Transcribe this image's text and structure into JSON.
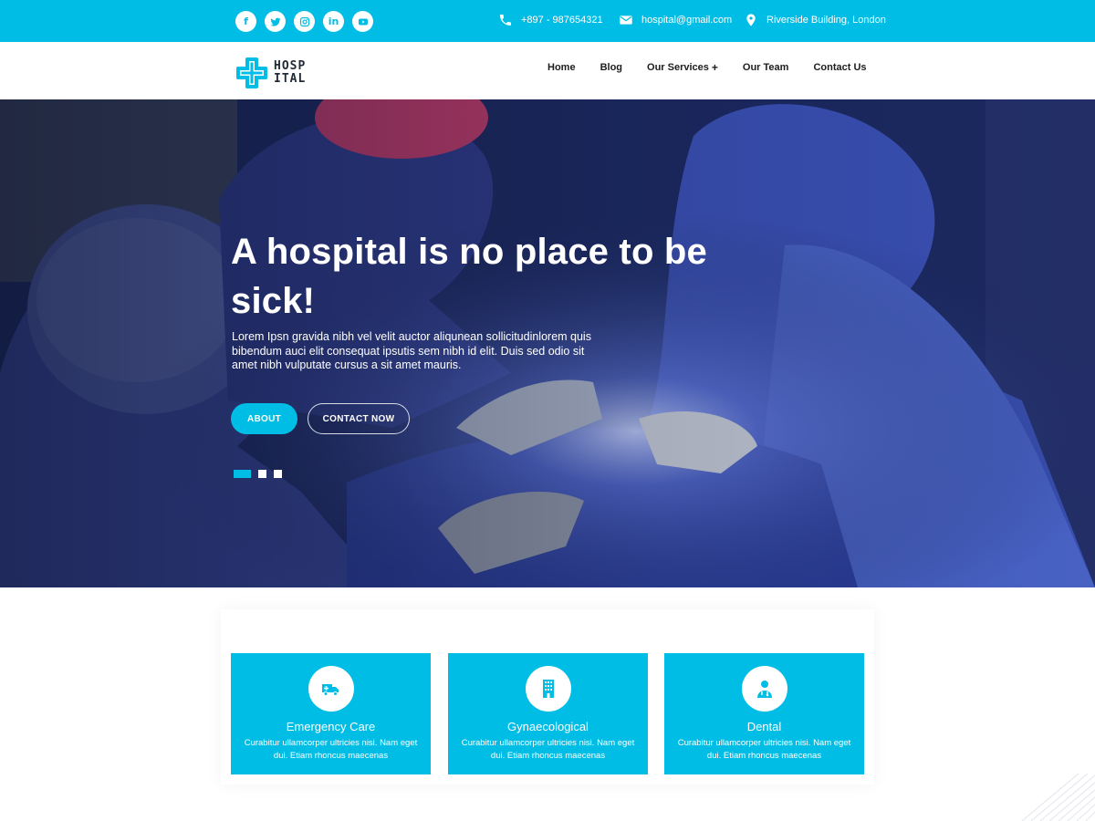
{
  "brand": {
    "accent": "#00bde5",
    "logo_line1": "HOSP",
    "logo_line2": "ITAL"
  },
  "topbar": {
    "socials": [
      {
        "icon": "facebook-icon",
        "glyph": "f"
      },
      {
        "icon": "twitter-icon",
        "glyph": ""
      },
      {
        "icon": "instagram-icon",
        "glyph": ""
      },
      {
        "icon": "linkedin-icon",
        "glyph": "in"
      },
      {
        "icon": "youtube-icon",
        "glyph": ""
      }
    ],
    "phone": "+897 - 987654321",
    "email": "hospital@gmail.com",
    "address": "Riverside Building, London"
  },
  "nav": {
    "home": "Home",
    "blog": "Blog",
    "services": "Our Services",
    "team": "Our Team",
    "contact": "Contact Us"
  },
  "hero": {
    "title": "A hospital is no place to be sick!",
    "text": "Lorem Ipsn gravida nibh vel velit auctor aliqunean sollicitudinlorem quis bibendum auci elit consequat ipsutis sem nibh id elit. Duis sed odio sit amet nibh vulputate cursus a sit amet mauris.",
    "about_label": "ABOUT",
    "contact_label": "CONTACT NOW",
    "slide_count": 3,
    "active_slide": 1
  },
  "services": [
    {
      "title": "Emergency Care",
      "text": "Curabitur ullamcorper ultricies nisi. Nam eget dui. Etiam rhoncus maecenas",
      "icon": "ambulance-icon"
    },
    {
      "title": "Gynaecological",
      "text": "Curabitur ullamcorper ultricies nisi. Nam eget dui. Etiam rhoncus maecenas",
      "icon": "hospital-building-icon"
    },
    {
      "title": "Dental",
      "text": "Curabitur ullamcorper ultricies nisi. Nam eget dui. Etiam rhoncus maecenas",
      "icon": "doctor-icon"
    }
  ]
}
